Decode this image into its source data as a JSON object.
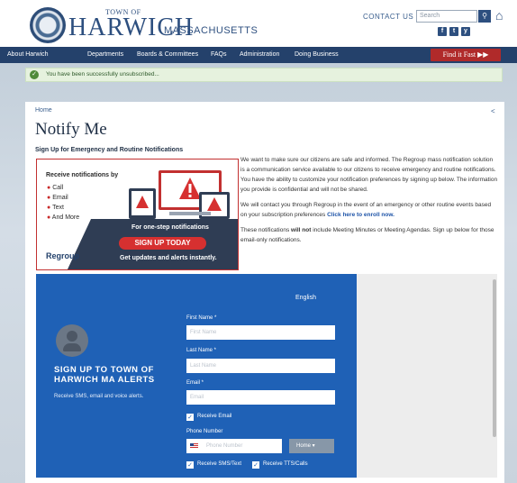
{
  "header": {
    "town_prefix": "TOWN OF",
    "town_name": "HARWICH",
    "state": "MASSACHUSETTS",
    "contact_link": "CONTACT US",
    "search_placeholder": "Search",
    "social": [
      "f",
      "t",
      "y"
    ]
  },
  "nav": {
    "items": [
      "About Harwich",
      "Departments",
      "Boards & Committees",
      "FAQs",
      "Administration",
      "Doing Business"
    ],
    "find_it_fast": "Find it Fast ▶▶"
  },
  "alert": {
    "message": "You have been successfully unsubscribed..."
  },
  "page": {
    "breadcrumb": "Home",
    "title": "Notify Me",
    "subtitle": "Sign Up for Emergency and Routine Notifications"
  },
  "promo": {
    "lead": "Receive notifications by",
    "methods": [
      "Call",
      "Email",
      "Text",
      "And More"
    ],
    "one_step": "For one-step notifications",
    "cta": "SIGN UP TODAY",
    "tagline": "Get updates and alerts instantly.",
    "brand": "Regroup"
  },
  "copy": {
    "p1": "We want to make sure our citizens are safe and informed. The Regroup mass notification solution is a communication service available to our citizens to receive emergency and routine notifications. You have the ability to customize your notification preferences by signing up below. The information you provide is confidential and will not be shared.",
    "p2_text": "We will contact you through Regroup in the event of an emergency or other routine events based on your subscription preferences ",
    "p2_link": "Click here to enroll now.",
    "p3_pre": "These notifications ",
    "p3_bold": "will not",
    "p3_post": " include Meeting Minutes or Meeting Agendas. Sign up below for those email-only notifications."
  },
  "widget": {
    "language": "English",
    "heading": "SIGN UP TO TOWN OF HARWICH MA ALERTS",
    "subheading": "Receive SMS, email and voice alerts.",
    "first_name_label": "First Name *",
    "first_name_placeholder": "First Name",
    "last_name_label": "Last Name *",
    "last_name_placeholder": "Last Name",
    "email_label": "Email *",
    "email_placeholder": "Email",
    "receive_email": "Receive Email",
    "phone_label": "Phone Number",
    "phone_placeholder": "Phone Number",
    "phone_type": "Home",
    "receive_sms": "Receive SMS/Text",
    "receive_tts": "Receive TTS/Calls"
  },
  "colors": {
    "brand_blue": "#2d4f7f",
    "nav_bg": "#24416b",
    "find_fast_red": "#b02a2a",
    "widget_blue": "#1f61b6"
  }
}
